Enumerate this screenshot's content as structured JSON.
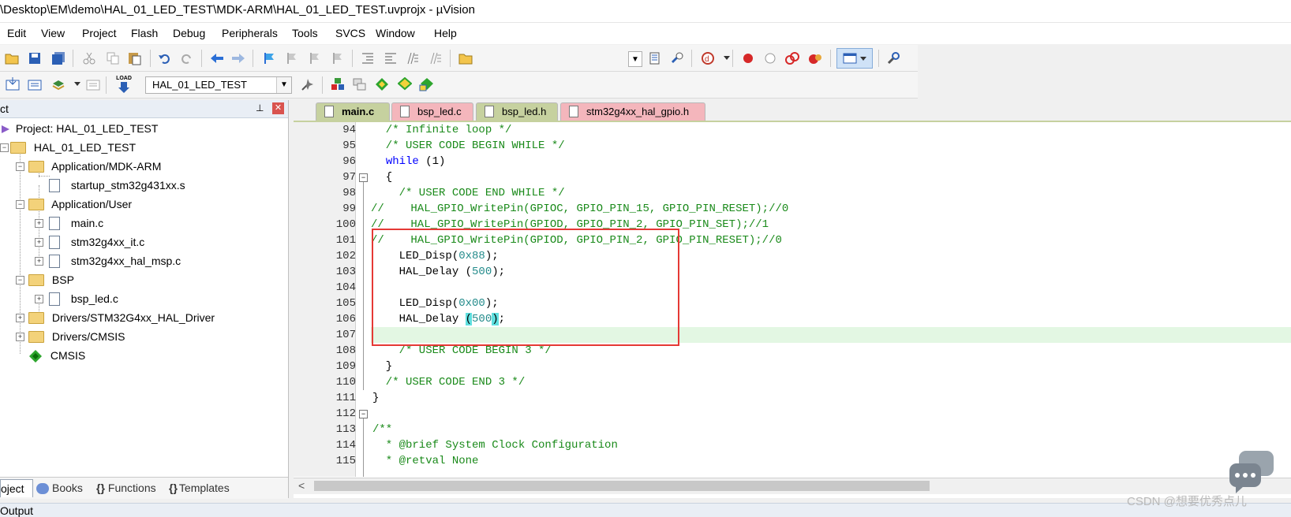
{
  "window": {
    "title": "\\Desktop\\EM\\demo\\HAL_01_LED_TEST\\MDK-ARM\\HAL_01_LED_TEST.uvprojx - µVision"
  },
  "menu": [
    "Edit",
    "View",
    "Project",
    "Flash",
    "Debug",
    "Peripherals",
    "Tools",
    "SVCS",
    "Window",
    "Help"
  ],
  "toolbar2": {
    "target": "HAL_01_LED_TEST",
    "load_label": "LOAD"
  },
  "project_panel": {
    "title": "ct",
    "tree": {
      "root": "Project: HAL_01_LED_TEST",
      "target": "HAL_01_LED_TEST",
      "app_mdk": "Application/MDK-ARM",
      "startup": "startup_stm32g431xx.s",
      "app_user": "Application/User",
      "main": "main.c",
      "it": "stm32g4xx_it.c",
      "msp": "stm32g4xx_hal_msp.c",
      "bsp": "BSP",
      "bsp_led": "bsp_led.c",
      "drivers_hal": "Drivers/STM32G4xx_HAL_Driver",
      "drivers_cmsis": "Drivers/CMSIS",
      "cmsis": "CMSIS"
    },
    "tabs": {
      "project": "oject",
      "books": "Books",
      "functions": "Functions",
      "templates": "Templates"
    }
  },
  "editor": {
    "tabs": [
      {
        "label": "main.c",
        "color": "#c6d19f"
      },
      {
        "label": "bsp_led.c",
        "color": "#f4b6bc"
      },
      {
        "label": "bsp_led.h",
        "color": "#c6d19f"
      },
      {
        "label": "stm32g4xx_hal_gpio.h",
        "color": "#f4b6bc"
      }
    ],
    "line_numbers": [
      "94",
      "95",
      "96",
      "97",
      "98",
      "99",
      "100",
      "101",
      "102",
      "103",
      "104",
      "105",
      "106",
      "107",
      "108",
      "109",
      "110",
      "111",
      "112",
      "113",
      "114",
      "115"
    ],
    "lines": {
      "l94": "  /* Infinite loop */",
      "l95": "  /* USER CODE BEGIN WHILE */",
      "l96kw": "while",
      "l96rest": " (1)",
      "l97": "  {",
      "l98": "    /* USER CODE END WHILE */",
      "l99": "//    HAL_GPIO_WritePin(GPIOC, GPIO_PIN_15, GPIO_PIN_RESET);//0",
      "l100": "//    HAL_GPIO_WritePin(GPIOD, GPIO_PIN_2, GPIO_PIN_SET);//1",
      "l101": "//    HAL_GPIO_WritePin(GPIOD, GPIO_PIN_2, GPIO_PIN_RESET);//0",
      "l102a": "    LED_Disp(",
      "l102n": "0x88",
      "l102b": ");",
      "l103a": "    HAL_Delay (",
      "l103n": "500",
      "l103b": ");",
      "l105a": "    LED_Disp(",
      "l105n": "0x00",
      "l105b": ");",
      "l106a": "    HAL_Delay ",
      "l106p1": "(",
      "l106n": "500",
      "l106p2": ")",
      "l106b": ";",
      "l108": "    /* USER CODE BEGIN 3 */",
      "l109": "  }",
      "l110": "  /* USER CODE END 3 */",
      "l111": "}",
      "l113": "/**",
      "l114": "  * @brief System Clock Configuration",
      "l115": "  * @retval None"
    }
  },
  "output": {
    "label": "Output"
  },
  "watermark": "CSDN @想要优秀点儿"
}
